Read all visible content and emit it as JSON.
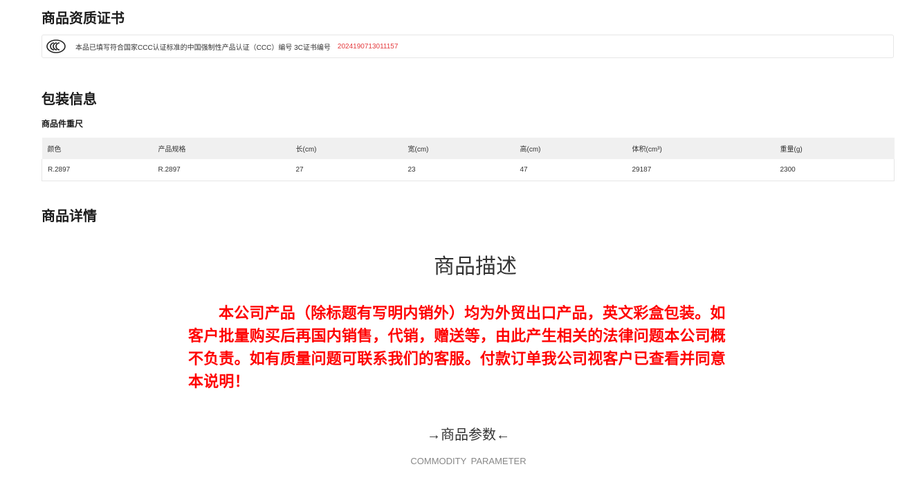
{
  "cert_section": {
    "title": "商品资质证书",
    "icon": "ccc-mark-icon",
    "text": "本品已填写符合国家CCC认证标准的中国强制性产品认证（CCC）编号 3C证书编号",
    "number": "2024190713011157",
    "number_color": "#e4393c"
  },
  "package_section": {
    "title": "包装信息",
    "subtitle": "商品件重尺",
    "columns": [
      "颜色",
      "产品规格",
      "长(cm)",
      "宽(cm)",
      "高(cm)",
      "体积(cm³)",
      "重量(g)"
    ],
    "rows": [
      [
        "R.2897",
        "R.2897",
        "27",
        "23",
        "47",
        "29187",
        "2300"
      ]
    ]
  },
  "detail_section": {
    "title": "商品详情",
    "desc_heading": "商品描述",
    "notice": "本公司产品（除标题有写明内销外）均为外贸出口产品，英文彩盒包装。如客户批量购买后再国内销售，代销，赠送等，由此产生相关的法律问题本公司概不负责。如有质量问题可联系我们的客服。付款订单我公司视客户已查看并同意本说明！",
    "notice_color": "#ff0000",
    "param_heading": "→商品参数←",
    "param_sub": "COMMODITY  PARAMETER"
  }
}
